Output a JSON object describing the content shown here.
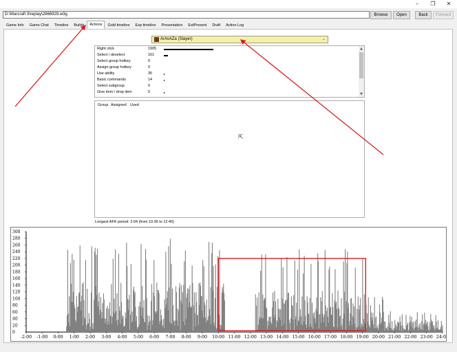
{
  "window": {
    "minimize_glyph": "–",
    "maximize_glyph": "❐",
    "close_glyph": "✕"
  },
  "toolbar": {
    "path": "D:\\Warcraft 3\\replay\\2866929.w3g",
    "browse": "Browse",
    "open": "Open",
    "back": "Back",
    "forward": "Forward"
  },
  "tabs": [
    {
      "label": "Game Info"
    },
    {
      "label": "Game Chat"
    },
    {
      "label": "Timeline"
    },
    {
      "label": "Builds"
    },
    {
      "label": "Actions"
    },
    {
      "label": "Gold timeline"
    },
    {
      "label": "Exp timeline"
    },
    {
      "label": "Presentation"
    },
    {
      "label": "ExtPresent"
    },
    {
      "label": "Draft"
    },
    {
      "label": "Action Log"
    }
  ],
  "player_select": {
    "value": "ArAvAZa (Slayer)",
    "chevron": "⌄",
    "icon": "hero-portrait-icon"
  },
  "actions": [
    {
      "name": "Right click",
      "count": "1905",
      "value": 1905
    },
    {
      "name": "Select / deselect",
      "count": "161",
      "value": 161
    },
    {
      "name": "Select group hotkey",
      "count": "0",
      "value": 0
    },
    {
      "name": "Assign group hotkey",
      "count": "0",
      "value": 0
    },
    {
      "name": "Use ability",
      "count": "35",
      "value": 35
    },
    {
      "name": "Basic commands",
      "count": "14",
      "value": 14
    },
    {
      "name": "Select subgroup",
      "count": "0",
      "value": 0
    },
    {
      "name": "Give item / drop item",
      "count": "5",
      "value": 5
    }
  ],
  "scroll": {
    "up": "▲",
    "down": "▼"
  },
  "groups_table": {
    "headers": [
      "Group",
      "Assigned",
      "Used"
    ]
  },
  "afk_text": "Longest AFK period: 2:04 (from 10:36 to 12:40)",
  "chart_data": {
    "type": "bar",
    "ylim": [
      0,
      300
    ],
    "yticks": [
      0,
      20,
      40,
      60,
      80,
      100,
      120,
      140,
      160,
      180,
      200,
      220,
      240,
      260,
      280,
      300
    ],
    "xtick_labels": [
      "-2:00",
      "-1:00",
      "0:00",
      "1:00",
      "2:00",
      "3:00",
      "4:00",
      "5:00",
      "6:00",
      "7:00",
      "8:00",
      "9:00",
      "10:00",
      "11:00",
      "12:00",
      "13:00",
      "14:00",
      "15:00",
      "16:00",
      "17:00",
      "18:00",
      "19:00",
      "20:00",
      "21:00",
      "22:00",
      "23:00",
      "24:00"
    ],
    "x_start_min": -2,
    "x_end_min": 24,
    "bar_color": "#808080",
    "highlight_color": "#d02020",
    "highlight_range_min": [
      10,
      19.2
    ],
    "segments": [
      {
        "from": 0.5,
        "to": 10.4,
        "avg": 120,
        "peak": 280
      },
      {
        "from": 12.3,
        "to": 19.1,
        "avg": 100,
        "peak": 250
      },
      {
        "from": 19.1,
        "to": 20.3,
        "avg": 50,
        "peak": 110
      },
      {
        "from": 20.3,
        "to": 24.0,
        "avg": 30,
        "peak": 65
      }
    ]
  },
  "annotations": {
    "arrow_color": "#d02020"
  }
}
